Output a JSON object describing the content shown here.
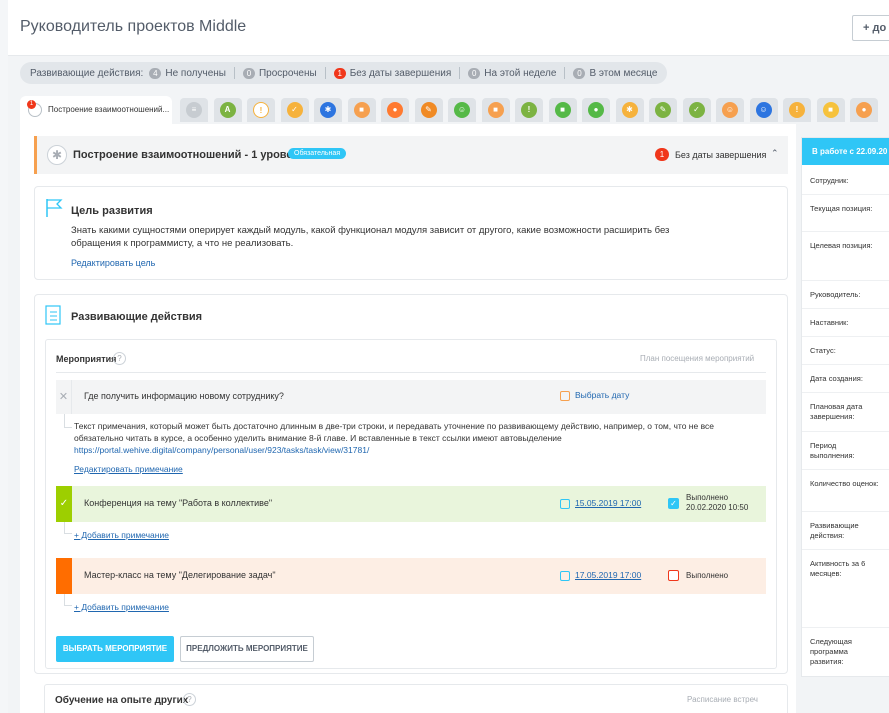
{
  "header": {
    "title": "Руководитель проектов Middle",
    "add_label": "+ до"
  },
  "filters": {
    "label": "Развивающие действия:",
    "items": [
      {
        "count": "4",
        "label": "Не получены",
        "red": false
      },
      {
        "count": "0",
        "label": "Просрочены",
        "red": false
      },
      {
        "count": "1",
        "label": "Без даты завершения",
        "red": true
      },
      {
        "count": "0",
        "label": "На этой неделе",
        "red": false
      },
      {
        "count": "0",
        "label": "В этом месяце",
        "red": false
      }
    ]
  },
  "tabs": {
    "active": {
      "label": "Построение взаимоотношений...",
      "badge": "1"
    },
    "icons": [
      {
        "name": "tab-blank-icon",
        "color": "#c7ccd1",
        "glyph": "≡"
      },
      {
        "name": "tab-letter-icon",
        "color": "#7cb342",
        "glyph": "A"
      },
      {
        "name": "tab-bulb-icon",
        "color": "#ffffff",
        "glyph": "!"
      },
      {
        "name": "tab-check-icon",
        "color": "#f6b23c",
        "glyph": "✓"
      },
      {
        "name": "tab-gear-icon",
        "color": "#2d75e0",
        "glyph": "✱"
      },
      {
        "name": "tab-badge-icon",
        "color": "#f6a04f",
        "glyph": "■"
      },
      {
        "name": "tab-chat-icon",
        "color": "#ff7a30",
        "glyph": "●"
      },
      {
        "name": "tab-pencil-icon",
        "color": "#f08a24",
        "glyph": "✎"
      },
      {
        "name": "tab-person-icon",
        "color": "#55b947",
        "glyph": "☺"
      },
      {
        "name": "tab-case-icon",
        "color": "#f6a04f",
        "glyph": "■"
      },
      {
        "name": "tab-bulb2-icon",
        "color": "#7cb342",
        "glyph": "!"
      },
      {
        "name": "tab-badge2-icon",
        "color": "#55b947",
        "glyph": "■"
      },
      {
        "name": "tab-chat2-icon",
        "color": "#55b947",
        "glyph": "●"
      },
      {
        "name": "tab-gear2-icon",
        "color": "#f6b23c",
        "glyph": "✱"
      },
      {
        "name": "tab-pencil2-icon",
        "color": "#7cb342",
        "glyph": "✎"
      },
      {
        "name": "tab-check2-icon",
        "color": "#7cb342",
        "glyph": "✓"
      },
      {
        "name": "tab-person2-icon",
        "color": "#f6a04f",
        "glyph": "☺"
      },
      {
        "name": "tab-person3-icon",
        "color": "#2d75e0",
        "glyph": "☺"
      },
      {
        "name": "tab-bulb3-icon",
        "color": "#f6b23c",
        "glyph": "!"
      },
      {
        "name": "tab-badge3-icon",
        "color": "#f6c23c",
        "glyph": "■"
      },
      {
        "name": "tab-chat3-icon",
        "color": "#f6a04f",
        "glyph": "●"
      }
    ]
  },
  "level": {
    "title": "Построение взаимоотношений - 1 уровень",
    "mandatory": "Обязательная",
    "badge": "1",
    "status": "Без даты завершения"
  },
  "goal": {
    "title": "Цель развития",
    "description": "Знать какими сущностями оперирует каждый модуль, какой функционал модуля зависит от другого, какие возможности расширить без обращения к программисту, а что не реализовать.",
    "edit_link": "Редактировать цель"
  },
  "dev": {
    "title": "Развивающие действия",
    "events_title": "Мероприятия",
    "plan_link": "План посещения мероприятий",
    "rows": [
      {
        "name": "Где получить информацию новому сотруднику?",
        "date_label": "Выбрать дату",
        "note": "Текст примечания, который может быть достаточно длинным в две-три строки, и передавать уточнение по развивающему действию, например, о том, что не все обязательно читать в курсе, а особенно уделить внимание 8-й главе. И вставленные в текст ссылки имеют автовыделение",
        "note_link": "https://portal.wehive.digital/company/personal/user/923/tasks/task/view/31781/",
        "edit_note": "Редактировать примечание"
      },
      {
        "name": "Конференция на тему \"Работа в коллективе\"",
        "date": "15.05.2019  17:00",
        "status": "Выполнено",
        "status_date": "20.02.2020 10:50",
        "add_note": "+ Добавить примечание"
      },
      {
        "name": "Мастер-класс на тему \"Делегирование задач\"",
        "date": "17.05.2019  17:00",
        "status": "Выполнено",
        "add_note": "+ Добавить примечание"
      }
    ],
    "choose_btn": "ВЫБРАТЬ МЕРОПРИЯТИЕ",
    "suggest_btn": "ПРЕДЛОЖИТЬ МЕРОПРИЯТИЕ"
  },
  "learn": {
    "title": "Обучение на опыте других",
    "schedule": "Расписание встреч"
  },
  "side": {
    "header": "В работе с 22.09.20",
    "labels": [
      "Сотрудник:",
      "Текущая позиция:",
      "Целевая позиция:",
      "Руководитель:",
      "Наставник:",
      "Статус:",
      "Дата создания:",
      "Плановая дата завершения:",
      "Период выполнения:",
      "Количество оценок:",
      "Развивающие действия:",
      "Активность за 6 месяцев:",
      "Следующая программа развития:"
    ]
  }
}
